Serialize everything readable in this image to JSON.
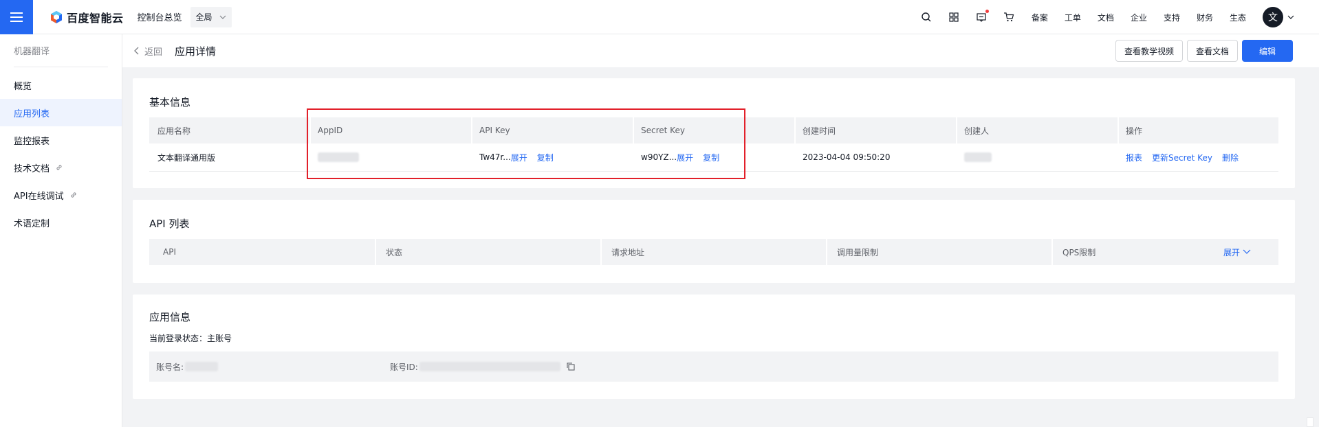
{
  "topbar": {
    "brand": "百度智能云",
    "console_link": "控制台总览",
    "region": "全局",
    "nav": [
      "备案",
      "工单",
      "文档",
      "企业",
      "支持",
      "财务",
      "生态"
    ],
    "avatar_text": "文"
  },
  "sidebar": {
    "title": "机器翻译",
    "items": [
      {
        "label": "概览"
      },
      {
        "label": "应用列表"
      },
      {
        "label": "监控报表"
      },
      {
        "label": "技术文档"
      },
      {
        "label": "API在线调试"
      },
      {
        "label": "术语定制"
      }
    ],
    "active_index": 1
  },
  "subheader": {
    "back": "返回",
    "title": "应用详情",
    "btn_video": "查看教学视频",
    "btn_docs": "查看文档",
    "btn_edit": "编辑"
  },
  "basic_info": {
    "title": "基本信息",
    "columns": [
      "应用名称",
      "AppID",
      "API Key",
      "Secret Key",
      "创建时间",
      "创建人",
      "操作"
    ],
    "row": {
      "app_name": "文本翻译通用版",
      "api_key_prefix": "Tw47r...",
      "secret_key_prefix": "w90YZ...",
      "expand": "展开",
      "copy": "复制",
      "created_at": "2023-04-04 09:50:20",
      "ops": [
        "报表",
        "更新Secret Key",
        "删除"
      ]
    }
  },
  "api_list": {
    "title": "API 列表",
    "columns": [
      "API",
      "状态",
      "请求地址",
      "调用量限制",
      "QPS限制"
    ],
    "expand": "展开"
  },
  "app_info": {
    "title": "应用信息",
    "login_status": "当前登录状态：主账号",
    "account_name_label": "账号名:",
    "account_id_label": "账号ID:"
  },
  "colors": {
    "primary": "#2468f2",
    "highlight_border": "#e2202a",
    "page_bg": "#f2f3f5"
  }
}
